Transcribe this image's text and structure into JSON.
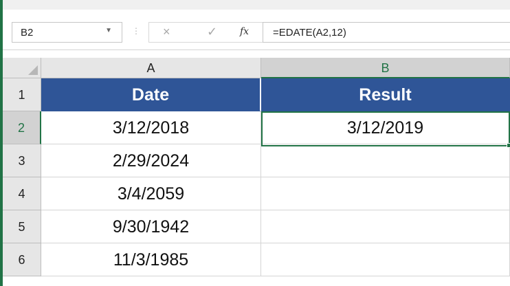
{
  "formula_bar": {
    "name_box": "B2",
    "cancel_icon": "×",
    "enter_icon": "✓",
    "fx_label": "fx",
    "formula": "=EDATE(A2,12)"
  },
  "columns": [
    {
      "label": "A"
    },
    {
      "label": "B"
    }
  ],
  "rows": [
    {
      "num": "1",
      "a": "Date",
      "b": "Result"
    },
    {
      "num": "2",
      "a": "3/12/2018",
      "b": "3/12/2019"
    },
    {
      "num": "3",
      "a": "2/29/2024",
      "b": ""
    },
    {
      "num": "4",
      "a": "3/4/2059",
      "b": ""
    },
    {
      "num": "5",
      "a": "9/30/1942",
      "b": ""
    },
    {
      "num": "6",
      "a": "11/3/1985",
      "b": ""
    }
  ],
  "active_cell": "B2",
  "colors": {
    "header_fill": "#2f5597",
    "selection_accent": "#217346"
  }
}
